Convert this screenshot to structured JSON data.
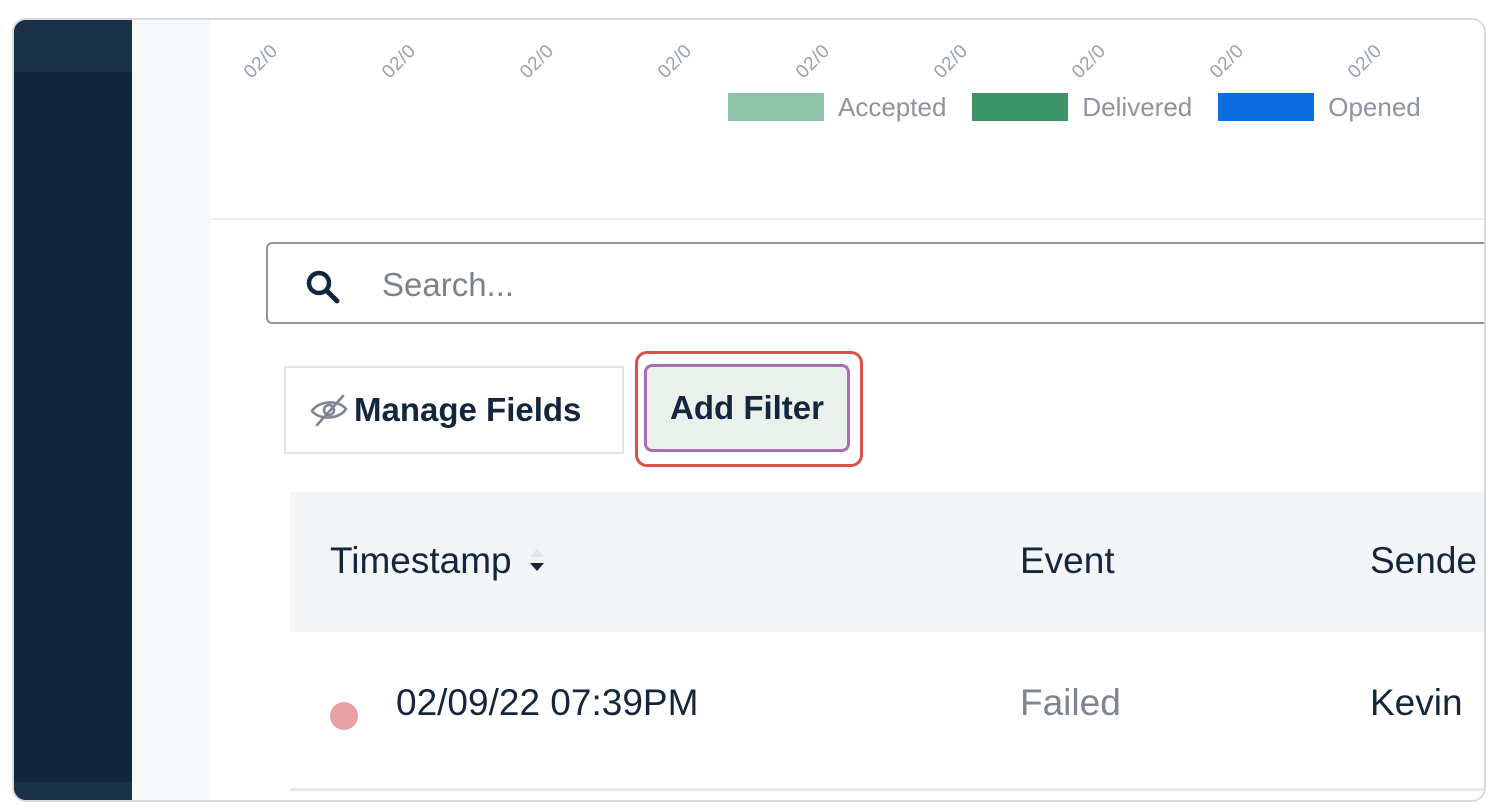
{
  "chart_fragment": {
    "tick_labels": [
      "02/0",
      "02/0",
      "02/0",
      "02/0",
      "02/0",
      "02/0",
      "02/0",
      "02/0",
      "02/0"
    ],
    "legend": [
      {
        "label": "Accepted",
        "color": "#8fc2a6"
      },
      {
        "label": "Delivered",
        "color": "#3a9466"
      },
      {
        "label": "Opened",
        "color": "#0a6cde"
      }
    ]
  },
  "search": {
    "placeholder": "Search..."
  },
  "toolbar": {
    "manage_fields_label": "Manage Fields",
    "add_filter_label": "Add Filter",
    "manage_fields_icon": "eye-slash-icon",
    "highlight_color": "#d9534a"
  },
  "table": {
    "columns": [
      "Timestamp",
      "Event",
      "Sende"
    ],
    "sort_icon": "sort-icon",
    "rows": [
      {
        "status_color": "#e8a1a3",
        "timestamp": "02/09/22 07:39PM",
        "event": "Failed",
        "sender": "Kevin"
      }
    ]
  },
  "colors": {
    "nav_background": "#13263d",
    "text_primary": "#13263d",
    "add_filter_border": "#a86fb4",
    "add_filter_background": "#eaf1ec"
  }
}
